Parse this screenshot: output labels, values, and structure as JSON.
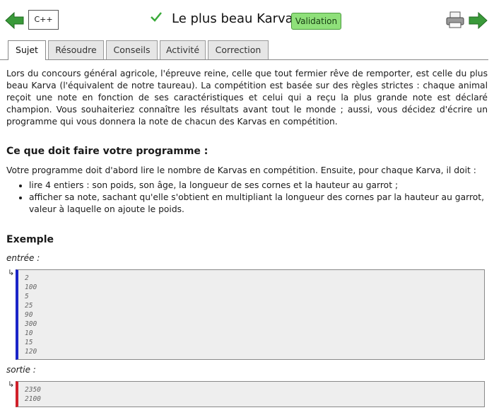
{
  "header": {
    "language": "C++",
    "title": "Le plus beau Karva",
    "validation_label": "Validation"
  },
  "tabs": [
    {
      "label": "Sujet",
      "active": true
    },
    {
      "label": "Résoudre",
      "active": false
    },
    {
      "label": "Conseils",
      "active": false
    },
    {
      "label": "Activité",
      "active": false
    },
    {
      "label": "Correction",
      "active": false
    }
  ],
  "statement": {
    "intro": "Lors du concours général agricole, l'épreuve reine, celle que tout fermier rêve de remporter, est celle du plus beau Karva (l'équivalent de notre taureau). La compétition est basée sur des règles strictes : chaque animal reçoit une note en fonction de ses caractéristiques et celui qui a reçu la plus grande note est déclaré champion. Vous souhaiteriez connaître les résultats avant tout le monde ; aussi, vous décidez d'écrire un programme qui vous donnera la note de chacun des Karvas en compétition.",
    "program_heading": "Ce que doit faire votre programme :",
    "program_text": "Votre programme doit d'abord lire le nombre de Karvas en compétition. Ensuite, pour chaque Karva, il doit :",
    "bullets": [
      "lire 4 entiers : son poids, son âge, la longueur de ses cornes et la hauteur au garrot ;",
      "afficher sa note, sachant qu'elle s'obtient en multipliant la longueur des cornes par la hauteur au garrot, valeur à laquelle on ajoute le poids."
    ]
  },
  "example": {
    "heading": "Exemple",
    "input_label": "entrée :",
    "input_lines": [
      "2",
      "100",
      "5",
      "25",
      "90",
      "300",
      "10",
      "15",
      "120"
    ],
    "output_label": "sortie :",
    "output_lines": [
      "2350",
      "2100"
    ]
  },
  "colors": {
    "validation_bg": "#8fe07a",
    "arrows": "#2e8b2e",
    "input_border": "#1a24c8",
    "output_border": "#d0202a"
  },
  "icons": [
    "arrow-left-icon",
    "check-icon",
    "printer-icon",
    "arrow-right-icon",
    "return-arrow-icon"
  ]
}
